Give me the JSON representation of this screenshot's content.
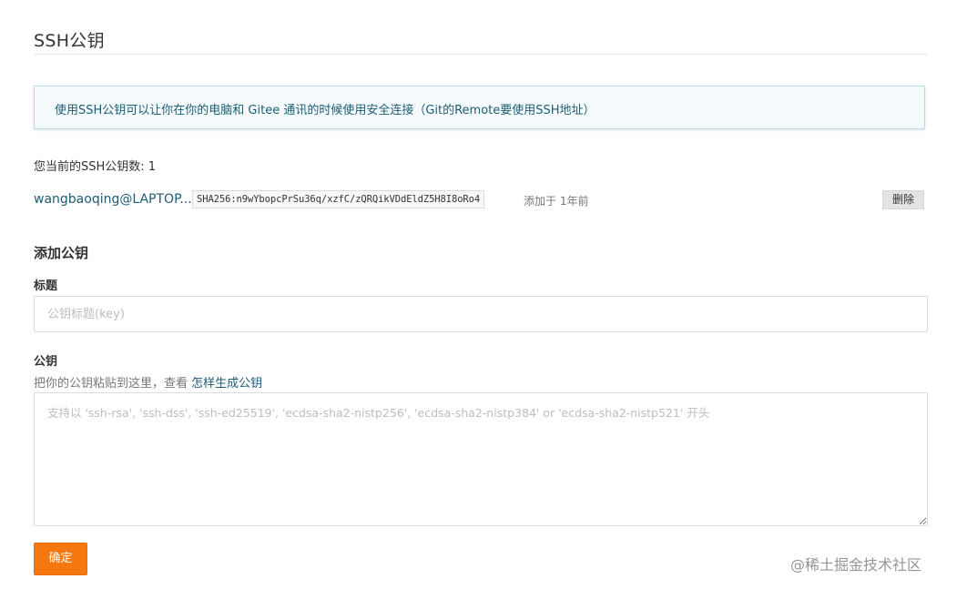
{
  "page": {
    "title": "SSH公钥"
  },
  "info": {
    "text": "使用SSH公钥可以让你在你的电脑和 Gitee 通讯的时候使用安全连接（Git的Remote要使用SSH地址）"
  },
  "keys": {
    "count_label": "您当前的SSH公钥数: 1",
    "items": [
      {
        "name": "wangbaoqing@LAPTOP...",
        "fingerprint": "SHA256:n9wYbopcPrSu36q/xzfC/zQRQikVDdEldZ5H8I8oRo4",
        "added": "添加于 1年前",
        "delete_label": "删除"
      }
    ]
  },
  "add_key": {
    "heading": "添加公钥",
    "title_label": "标题",
    "title_placeholder": "公钥标题(key)",
    "title_value": "",
    "key_label": "公钥",
    "hint_prefix": "把你的公钥粘贴到这里，查看 ",
    "hint_link": "怎样生成公钥",
    "key_placeholder": "支持以 'ssh-rsa', 'ssh-dss', 'ssh-ed25519', 'ecdsa-sha2-nistp256', 'ecdsa-sha2-nistp384' or 'ecdsa-sha2-nistp521' 开头",
    "key_value": "",
    "confirm_label": "确定"
  },
  "watermark": {
    "text": "@稀土掘金技术社区"
  },
  "colors": {
    "accent": "#f5770f",
    "link": "#1c5c75",
    "info_bg": "#f5fbfd",
    "info_border": "#b3dde8"
  }
}
